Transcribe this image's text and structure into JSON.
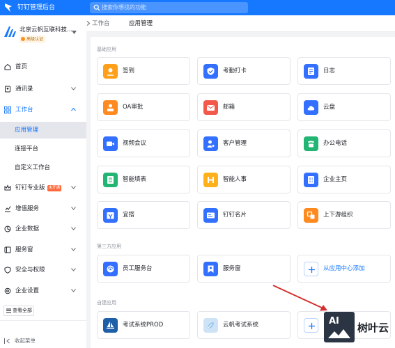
{
  "topbar": {
    "title": "钉钉管理后台",
    "search_placeholder": "搜索你想找的功能"
  },
  "org": {
    "name": "北京云帆互联科技...",
    "badge": "高级认证"
  },
  "nav": [
    {
      "label": "首页",
      "icon": "home-icon"
    },
    {
      "label": "通讯录",
      "icon": "contacts-icon"
    },
    {
      "label": "工作台",
      "icon": "grid-icon",
      "active_color": "#1677ff"
    },
    {
      "label": "应用管理",
      "sub": true,
      "active": true
    },
    {
      "label": "连接平台",
      "sub": true
    },
    {
      "label": "自定义工作台",
      "sub": true
    },
    {
      "label": "钉钉专业版",
      "icon": "crown-icon",
      "tag": "未开通"
    },
    {
      "label": "增值服务",
      "icon": "chart-icon"
    },
    {
      "label": "企业数据",
      "icon": "data-icon"
    },
    {
      "label": "服务窗",
      "icon": "window-icon"
    },
    {
      "label": "安全与权限",
      "icon": "shield-icon"
    },
    {
      "label": "企业设置",
      "icon": "settings-icon"
    }
  ],
  "sidebar_footer": {
    "view_all": "查看全部",
    "collapse": "收起菜单"
  },
  "breadcrumb": {
    "root": "工作台",
    "current": "应用管理"
  },
  "sections": {
    "basic": "基础应用",
    "third_party": "第三方应用",
    "self_built": "自建应用"
  },
  "apps_basic": [
    {
      "label": "签到",
      "color": "#ff9f1a",
      "icon": "location-icon"
    },
    {
      "label": "考勤打卡",
      "color": "#3370ff",
      "icon": "checkin-icon"
    },
    {
      "label": "日志",
      "color": "#3370ff",
      "icon": "log-icon"
    },
    {
      "label": "OA审批",
      "color": "#ff8a1f",
      "icon": "approval-icon"
    },
    {
      "label": "邮箱",
      "color": "#f2594b",
      "icon": "mail-icon"
    },
    {
      "label": "云盘",
      "color": "#3370ff",
      "icon": "cloud-icon"
    },
    {
      "label": "视频会议",
      "color": "#3370ff",
      "icon": "video-icon"
    },
    {
      "label": "客户管理",
      "color": "#3370ff",
      "icon": "customer-icon"
    },
    {
      "label": "办公电话",
      "color": "#22b573",
      "icon": "phone-icon"
    },
    {
      "label": "智能填表",
      "color": "#22b573",
      "icon": "form-icon"
    },
    {
      "label": "智能人事",
      "color": "#ffb11b",
      "icon": "hr-icon"
    },
    {
      "label": "企业主页",
      "color": "#3370ff",
      "icon": "homepage-icon"
    },
    {
      "label": "宜搭",
      "color": "#3370ff",
      "icon": "yida-icon"
    },
    {
      "label": "钉钉名片",
      "color": "#3370ff",
      "icon": "card-icon"
    },
    {
      "label": "上下游组织",
      "color": "#ff8a1f",
      "icon": "org-link-icon"
    }
  ],
  "apps_third_party": [
    {
      "label": "员工服务台",
      "color": "#3370ff",
      "icon": "service-icon"
    },
    {
      "label": "服务窗",
      "color": "#3370ff",
      "icon": "ribbon-icon"
    },
    {
      "label": "从应用中心添加",
      "add": true
    }
  ],
  "apps_self_built": [
    {
      "label": "考试系统PROD",
      "color": "#1e5fa8",
      "icon": "sailboat-icon"
    },
    {
      "label": "云帆考试系统",
      "color": "#cfe3f7",
      "icon": "leaf-icon"
    },
    {
      "label": "",
      "add": true
    }
  ],
  "watermark": {
    "box_text": "AI",
    "text": "树叶云"
  }
}
